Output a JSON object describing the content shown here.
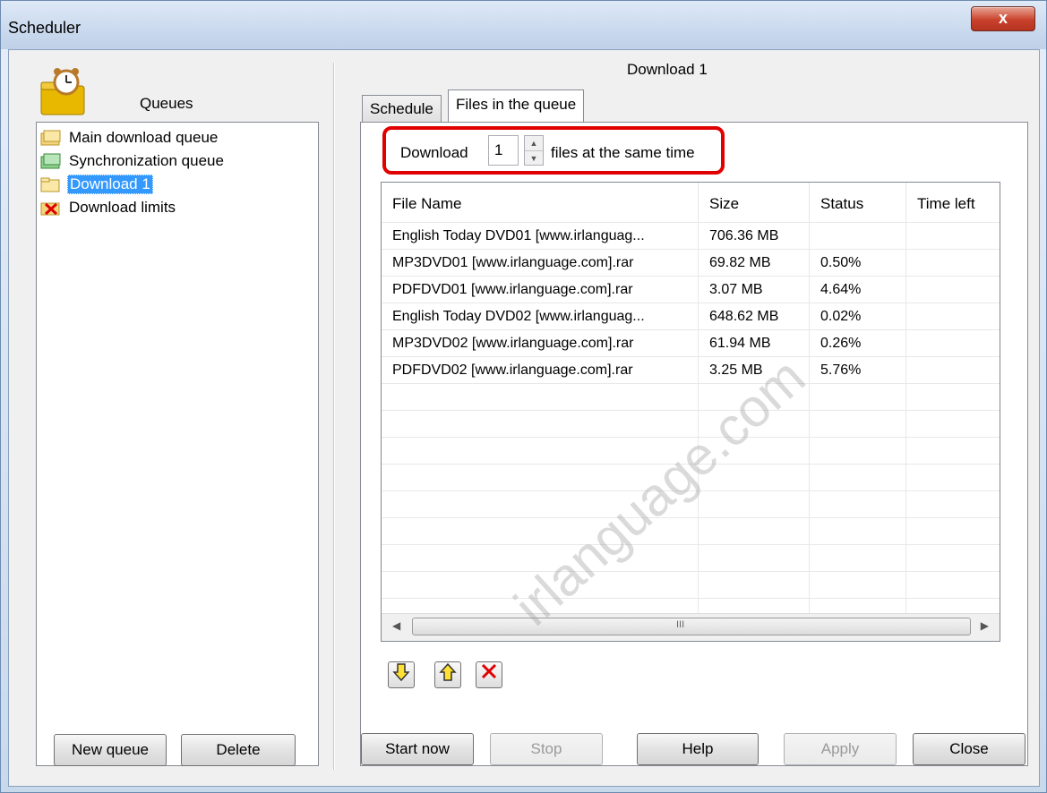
{
  "window": {
    "title": "Scheduler",
    "close_glyph": "x"
  },
  "left": {
    "heading": "Queues",
    "queues": [
      {
        "label": "Main download queue",
        "icon": "folder-queue-icon",
        "selected": false
      },
      {
        "label": "Synchronization queue",
        "icon": "folder-sync-icon",
        "selected": false
      },
      {
        "label": "Download 1",
        "icon": "folder-icon",
        "selected": true
      },
      {
        "label": "Download limits",
        "icon": "download-limits-icon",
        "selected": false
      }
    ],
    "new_queue_label": "New queue",
    "delete_label": "Delete"
  },
  "right": {
    "title": "Download 1",
    "tabs": [
      {
        "label": "Schedule"
      },
      {
        "label": "Files in the queue"
      }
    ],
    "concurrent": {
      "prefix": "Download",
      "value": "1",
      "suffix": "files at the same time"
    },
    "columns": [
      "File Name",
      "Size",
      "Status",
      "Time left"
    ],
    "files": [
      {
        "name": "English Today DVD01 [www.irlanguag...",
        "size": "706.36  MB",
        "status": "",
        "time_left": ""
      },
      {
        "name": "MP3DVD01 [www.irlanguage.com].rar",
        "size": "69.82  MB",
        "status": "0.50%",
        "time_left": ""
      },
      {
        "name": "PDFDVD01 [www.irlanguage.com].rar",
        "size": "3.07  MB",
        "status": "4.64%",
        "time_left": ""
      },
      {
        "name": "English Today DVD02 [www.irlanguag...",
        "size": "648.62  MB",
        "status": "0.02%",
        "time_left": ""
      },
      {
        "name": "MP3DVD02 [www.irlanguage.com].rar",
        "size": "61.94  MB",
        "status": "0.26%",
        "time_left": ""
      },
      {
        "name": "PDFDVD02 [www.irlanguage.com].rar",
        "size": "3.25  MB",
        "status": "5.76%",
        "time_left": ""
      }
    ],
    "scroll_grip": "III"
  },
  "footer": {
    "start_now": "Start now",
    "stop": "Stop",
    "help": "Help",
    "apply": "Apply",
    "close": "Close"
  },
  "watermark": "irlanguage.com",
  "colors": {
    "selection": "#3399ff",
    "highlight": "#e00000"
  }
}
